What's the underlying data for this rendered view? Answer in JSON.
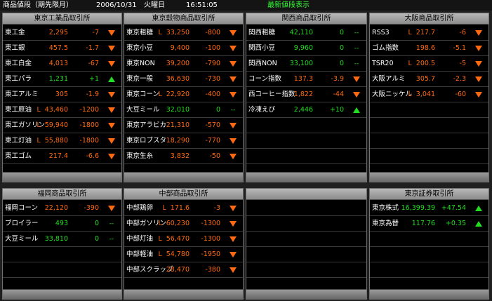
{
  "header": {
    "title": "商品値段（期先限月）",
    "date": "2006/10/31",
    "weekday": "火曜日",
    "time": "16:51:05",
    "refresh_label": "最新値段表示"
  },
  "colors": {
    "down": "#ff6a10",
    "up": "#22dd22",
    "unchanged": "#22dd22",
    "neutral": "#ffffff"
  },
  "panels": [
    {
      "id": "tokyo-industrial",
      "title": "東京工業品取引所",
      "rows": [
        {
          "name": "東工金",
          "limit": "",
          "price": "2,295",
          "change": "-7",
          "dir": "down"
        },
        {
          "name": "東工銀",
          "limit": "",
          "price": "457.5",
          "change": "-1.7",
          "dir": "down"
        },
        {
          "name": "東工白金",
          "limit": "",
          "price": "4,013",
          "change": "-67",
          "dir": "down"
        },
        {
          "name": "東工パラ",
          "limit": "",
          "price": "1,231",
          "change": "+1",
          "dir": "up"
        },
        {
          "name": "東工アルミ",
          "limit": "",
          "price": "305",
          "change": "-1.9",
          "dir": "down"
        },
        {
          "name": "東工原油",
          "limit": "L",
          "price": "43,460",
          "change": "-1200",
          "dir": "down"
        },
        {
          "name": "東工ガソリン",
          "limit": "L",
          "price": "59,940",
          "change": "-1800",
          "dir": "down"
        },
        {
          "name": "東工灯油",
          "limit": "L",
          "price": "55,880",
          "change": "-1800",
          "dir": "down"
        },
        {
          "name": "東工ゴム",
          "limit": "",
          "price": "217.4",
          "change": "-6.6",
          "dir": "down"
        }
      ]
    },
    {
      "id": "tokyo-grain",
      "title": "東京穀物商品取引所",
      "rows": [
        {
          "name": "東京粗糖",
          "limit": "L",
          "price": "33,250",
          "change": "-800",
          "dir": "down"
        },
        {
          "name": "東京小豆",
          "limit": "",
          "price": "9,400",
          "change": "-100",
          "dir": "down"
        },
        {
          "name": "東京NON",
          "limit": "",
          "price": "39,200",
          "change": "-790",
          "dir": "down"
        },
        {
          "name": "東京一般",
          "limit": "",
          "price": "36,630",
          "change": "-730",
          "dir": "down"
        },
        {
          "name": "東京コーン",
          "limit": "L",
          "price": "22,920",
          "change": "-400",
          "dir": "down"
        },
        {
          "name": "大豆ミール",
          "limit": "",
          "price": "32,010",
          "change": "0",
          "dir": "flat"
        },
        {
          "name": "東京アラビカ",
          "limit": "",
          "price": "21,310",
          "change": "-570",
          "dir": "down"
        },
        {
          "name": "東京ロブスタ",
          "limit": "",
          "price": "18,290",
          "change": "-770",
          "dir": "down"
        },
        {
          "name": "東京生糸",
          "limit": "",
          "price": "3,832",
          "change": "-50",
          "dir": "down"
        }
      ]
    },
    {
      "id": "kansai",
      "title": "関西商品取引所",
      "rows": [
        {
          "name": "関西粗糖",
          "limit": "",
          "price": "42,110",
          "change": "0",
          "dir": "flat"
        },
        {
          "name": "関西小豆",
          "limit": "",
          "price": "9,960",
          "change": "0",
          "dir": "flat"
        },
        {
          "name": "関西NON",
          "limit": "",
          "price": "33,100",
          "change": "0",
          "dir": "flat"
        },
        {
          "name": "コーン指数",
          "limit": "",
          "price": "137.3",
          "change": "-3.9",
          "dir": "down"
        },
        {
          "name": "西コーヒー指数",
          "limit": "",
          "price": "1,822",
          "change": "-44",
          "dir": "down"
        },
        {
          "name": "冷凍えび",
          "limit": "",
          "price": "2,446",
          "change": "+10",
          "dir": "up"
        }
      ]
    },
    {
      "id": "osaka",
      "title": "大阪商品取引所",
      "rows": [
        {
          "name": "RSS3",
          "limit": "L",
          "price": "217.7",
          "change": "-6",
          "dir": "down"
        },
        {
          "name": "ゴム指数",
          "limit": "",
          "price": "198.6",
          "change": "-5.1",
          "dir": "down"
        },
        {
          "name": "TSR20",
          "limit": "L",
          "price": "200.5",
          "change": "-5",
          "dir": "down"
        },
        {
          "name": "大阪アルミ",
          "limit": "",
          "price": "305.7",
          "change": "-2.3",
          "dir": "down"
        },
        {
          "name": "大阪ニッケル",
          "limit": "L",
          "price": "3,041",
          "change": "-60",
          "dir": "down"
        }
      ]
    },
    {
      "id": "fukuoka",
      "title": "福岡商品取引所",
      "rows": [
        {
          "name": "福岡コーン",
          "limit": "",
          "price": "22,120",
          "change": "-390",
          "dir": "down"
        },
        {
          "name": "ブロイラー",
          "limit": "",
          "price": "493",
          "change": "0",
          "dir": "flat"
        },
        {
          "name": "大豆ミール",
          "limit": "",
          "price": "33,810",
          "change": "0",
          "dir": "flat"
        }
      ]
    },
    {
      "id": "chubu",
      "title": "中部商品取引所",
      "rows": [
        {
          "name": "中部鶏卵",
          "limit": "L",
          "price": "171.6",
          "change": "-3",
          "dir": "down"
        },
        {
          "name": "中部ガソリン",
          "limit": "L",
          "price": "60,230",
          "change": "-1300",
          "dir": "down"
        },
        {
          "name": "中部灯油",
          "limit": "L",
          "price": "56,470",
          "change": "-1300",
          "dir": "down"
        },
        {
          "name": "中部軽油",
          "limit": "L",
          "price": "54,780",
          "change": "-1950",
          "dir": "down"
        },
        {
          "name": "中部スクラップ",
          "limit": "",
          "price": "28,470",
          "change": "-380",
          "dir": "down"
        }
      ]
    },
    {
      "id": "empty",
      "title": "",
      "rows": []
    },
    {
      "id": "tokyo-stock",
      "title": "東京証券取引所",
      "rows": [
        {
          "name": "東京株式",
          "limit": "",
          "price": "16,399.39",
          "change": "+47.54",
          "dir": "up"
        },
        {
          "name": "東京為替",
          "limit": "",
          "price": "117.76",
          "change": "+0.35",
          "dir": "up"
        }
      ]
    }
  ]
}
